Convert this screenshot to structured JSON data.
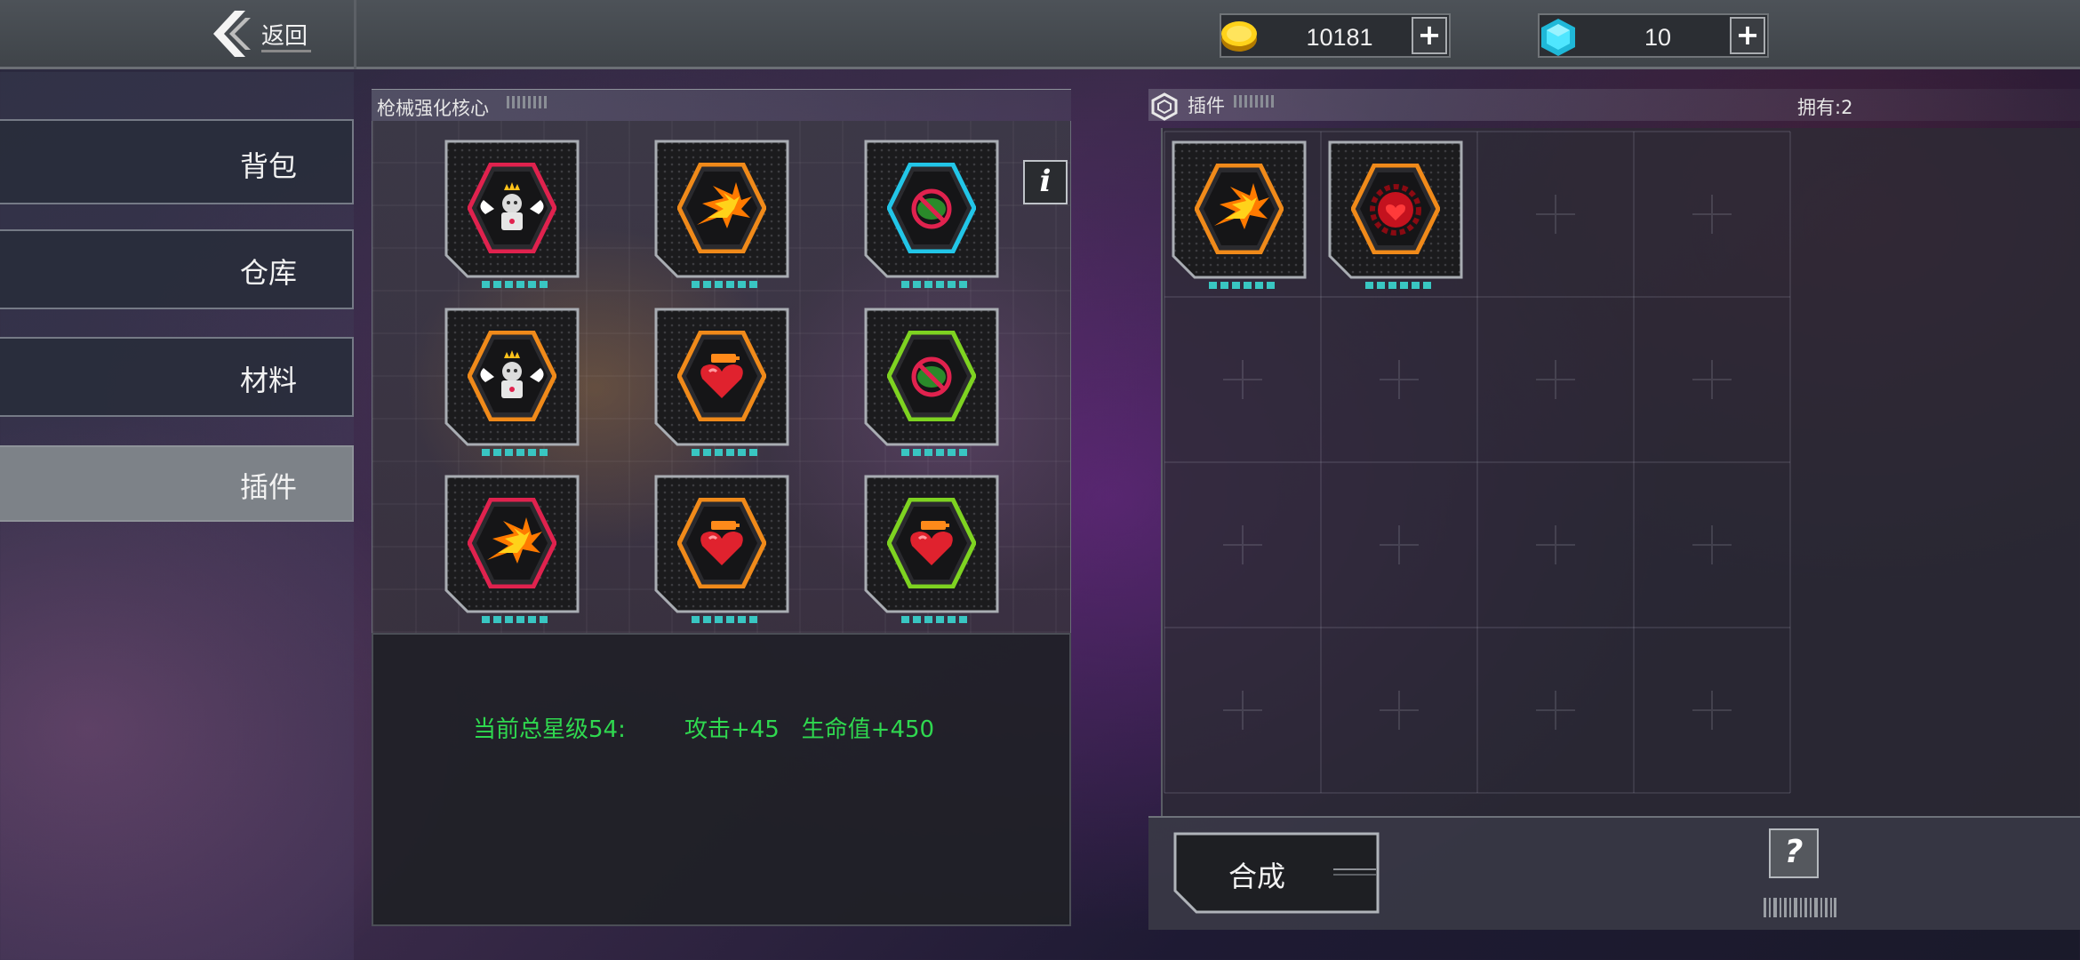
{
  "topbar": {
    "back_label": "返回",
    "gold": {
      "icon": "gold-coin-icon",
      "amount": "10181",
      "add_label": "+"
    },
    "gems": {
      "icon": "cyan-gem-icon",
      "amount": "10",
      "add_label": "+"
    }
  },
  "sidebar": {
    "items": [
      {
        "label": "背包",
        "active": false
      },
      {
        "label": "仓库",
        "active": false
      },
      {
        "label": "材料",
        "active": false
      },
      {
        "label": "插件",
        "active": true
      }
    ]
  },
  "core": {
    "title": "枪械强化核心",
    "info_label": "i",
    "slots": [
      {
        "icon": "angel-robot-icon",
        "border": "#e0224e",
        "stars": 6
      },
      {
        "icon": "fire-burst-icon",
        "border": "#f08a1a",
        "stars": 6
      },
      {
        "icon": "no-poison-icon",
        "border": "#22c6e8",
        "stars": 6
      },
      {
        "icon": "angel-robot-icon",
        "border": "#f08a1a",
        "stars": 6
      },
      {
        "icon": "heart-battery-icon",
        "border": "#f08a1a",
        "stars": 6
      },
      {
        "icon": "no-poison-icon",
        "border": "#7ed321",
        "stars": 6
      },
      {
        "icon": "fire-burst-icon",
        "border": "#e0224e",
        "stars": 6
      },
      {
        "icon": "heart-battery-icon",
        "border": "#f08a1a",
        "stars": 6
      },
      {
        "icon": "heart-battery-icon",
        "border": "#7ed321",
        "stars": 6
      }
    ],
    "stats": {
      "star_total": "当前总星级54:",
      "attack": "攻击+45",
      "hp": "生命值+450"
    }
  },
  "plugins": {
    "title": "插件",
    "owned": "拥有:2",
    "items": [
      {
        "icon": "fire-burst-icon",
        "border": "#f08a1a",
        "stars": 6
      },
      {
        "icon": "red-gear-heart-icon",
        "border": "#f08a1a",
        "stars": 6
      }
    ],
    "compose_label": "合成",
    "help_label": "?"
  },
  "colors": {
    "stat_green": "#2fd84f",
    "star_cyan": "#39c6c2",
    "hex_red": "#e0224e",
    "hex_orange": "#f08a1a",
    "hex_cyan": "#22c6e8",
    "hex_green": "#7ed321"
  }
}
